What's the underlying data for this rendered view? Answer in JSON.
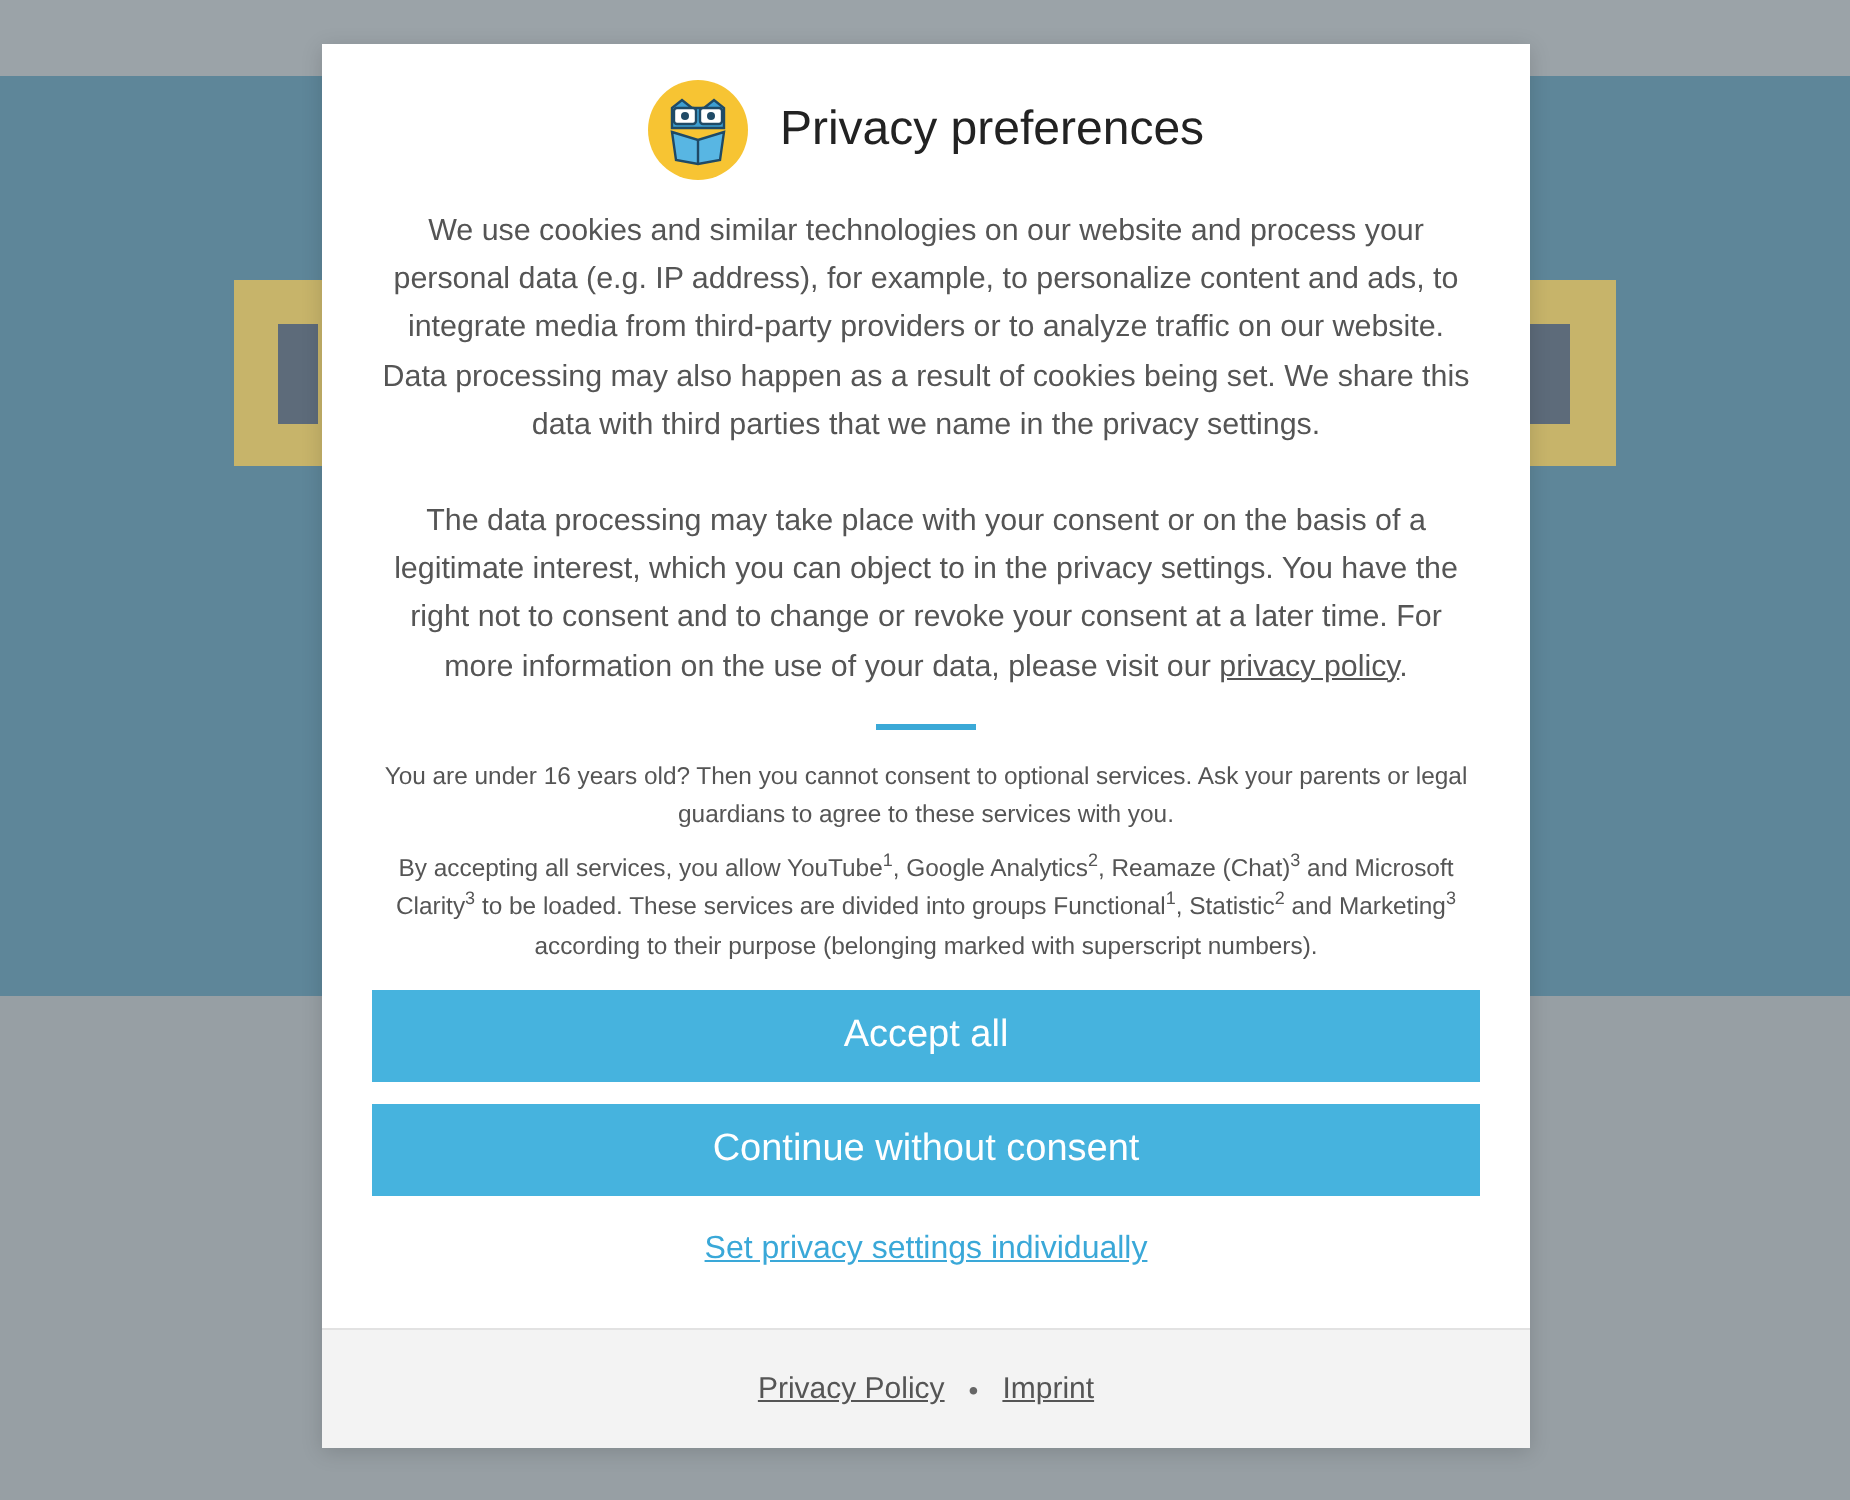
{
  "dialog": {
    "title": "Privacy preferences",
    "paragraphs": [
      "We use cookies and similar technologies on our website and process your personal data (e.g. IP address), for example, to personalize content and ads, to integrate media from third-party providers or to analyze traffic on our website. Data processing may also happen as a result of cookies being set. We share this data with third parties that we name in the privacy settings."
    ],
    "consent_text": "The data processing may take place with your consent or on the basis of a legitimate interest, which you can object to in the privacy settings. You have the right not to consent and to change or revoke your consent at a later time. For more information on the use of your data, please visit our",
    "consent_link": "privacy policy",
    "consent_end": ".",
    "age_notice": "You are under 16 years old? Then you cannot consent to optional services. Ask your parents or legal guardians to agree to these services with you.",
    "services_notice": "By accepting all services, you allow YouTube$^{1}$, Google Analytics$^{2}$, Reamaze (Chat)$^{3}$ and Microsoft Clarity$^{3}$ to be loaded. These services are divided into groups Functional$^{1}$, Statistic$^{2}$ and Marketing$^{3}$ according to their purpose (belonging marked with superscript numbers).",
    "buttons": [
      {
        "label": "Accept all",
        "kind": "primary"
      },
      {
        "label": "Continue without consent",
        "kind": "primary"
      },
      {
        "label": "Set privacy settings individually",
        "kind": "link"
      }
    ],
    "footer_links": [
      "Privacy Policy",
      "Imprint"
    ],
    "footer_separator": "•"
  }
}
